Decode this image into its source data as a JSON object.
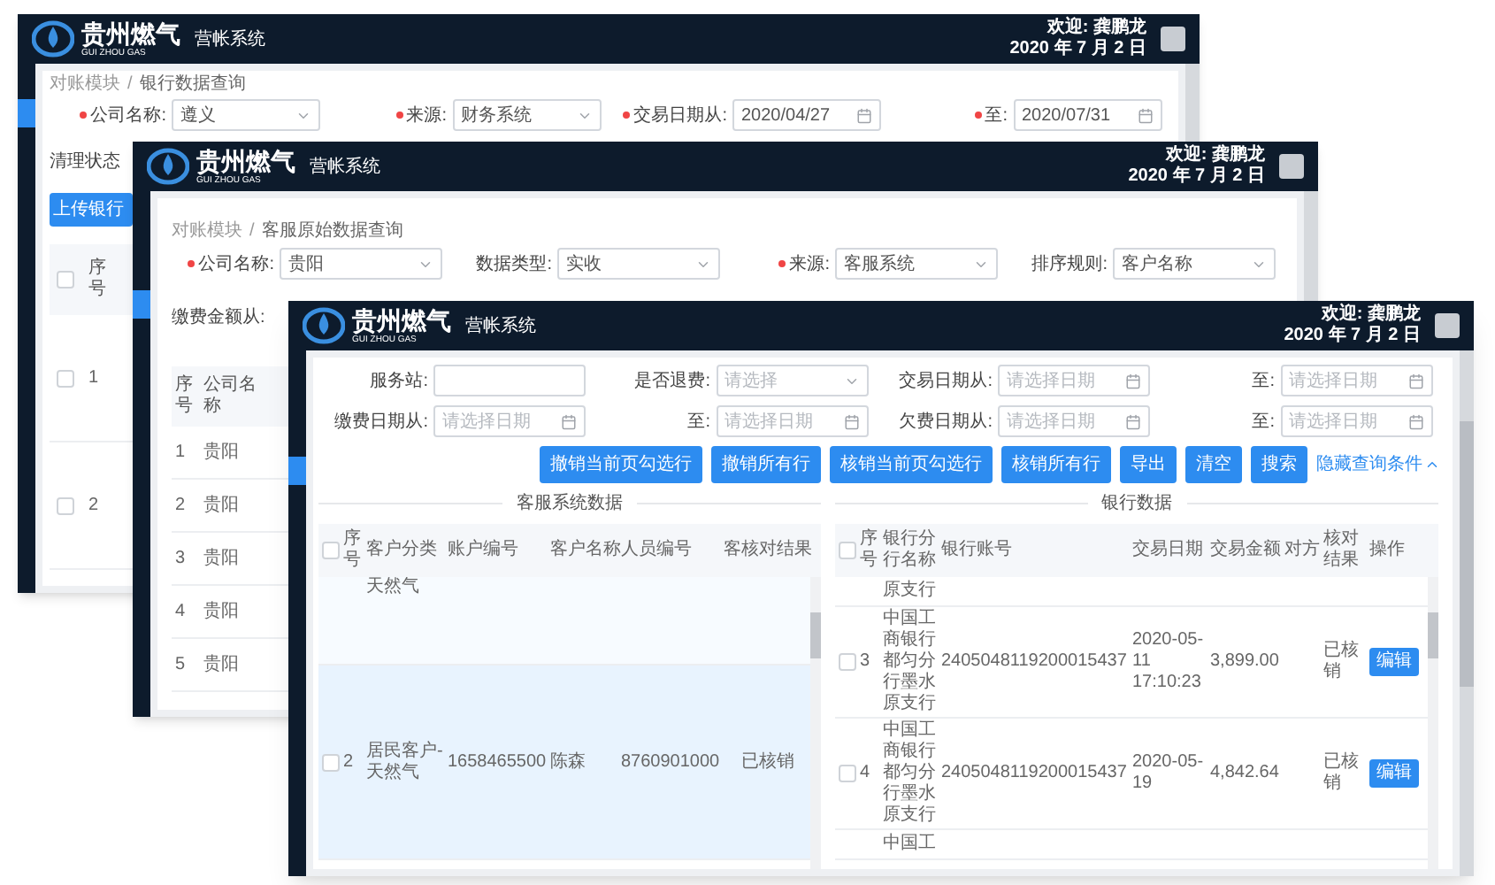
{
  "windows": [
    {
      "header": {
        "brand": "贵州燃气",
        "brand_en": "GUI ZHOU GAS",
        "system": "营帐系统",
        "welcome": "欢迎: 龚鹏龙",
        "date": "2020 年 7 月 2 日"
      },
      "breadcrumb": [
        "对账模块",
        "银行数据查询"
      ],
      "separator": "/",
      "filters": [
        {
          "label": "公司名称:",
          "required": true,
          "kind": "select",
          "value": "遵义"
        },
        {
          "label": "来源:",
          "required": true,
          "kind": "select",
          "value": "财务系统"
        },
        {
          "label": "交易日期从:",
          "required": true,
          "kind": "date",
          "value": "2020/04/27"
        },
        {
          "label": "至:",
          "required": true,
          "kind": "date",
          "value": "2020/07/31"
        }
      ],
      "side_label": "清理状态",
      "side_button": "上传银行",
      "table": {
        "columns": [
          "序号"
        ],
        "header_checked": false,
        "rows": [
          {
            "index": "1",
            "checked": false
          },
          {
            "index": "2",
            "checked": false
          }
        ]
      }
    },
    {
      "header": {
        "brand": "贵州燃气",
        "brand_en": "GUI ZHOU GAS",
        "system": "营帐系统",
        "welcome": "欢迎: 龚鹏龙",
        "date": "2020 年 7 月 2 日"
      },
      "breadcrumb": [
        "对账模块",
        "客服原始数据查询"
      ],
      "separator": "/",
      "filters": [
        {
          "label": "公司名称:",
          "required": true,
          "kind": "select",
          "value": "贵阳"
        },
        {
          "label": "数据类型:",
          "required": false,
          "kind": "select",
          "value": "实收"
        },
        {
          "label": "来源:",
          "required": true,
          "kind": "select",
          "value": "客服系统"
        },
        {
          "label": "排序规则:",
          "required": false,
          "kind": "select",
          "value": "客户名称"
        }
      ],
      "side_label": "缴费金额从:",
      "table": {
        "columns": [
          "序号",
          "公司名称"
        ],
        "rows": [
          {
            "index": "1",
            "company": "贵阳"
          },
          {
            "index": "2",
            "company": "贵阳"
          },
          {
            "index": "3",
            "company": "贵阳"
          },
          {
            "index": "4",
            "company": "贵阳"
          },
          {
            "index": "5",
            "company": "贵阳"
          }
        ]
      }
    },
    {
      "header": {
        "brand": "贵州燃气",
        "brand_en": "GUI ZHOU GAS",
        "system": "营帐系统",
        "welcome": "欢迎: 龚鹏龙",
        "date": "2020 年 7 月 2 日"
      },
      "filters": [
        {
          "label": "服务站:",
          "required": false,
          "kind": "text"
        },
        {
          "label": "是否退费:",
          "required": false,
          "kind": "select",
          "placeholder": "请选择"
        },
        {
          "label": "交易日期从:",
          "required": false,
          "kind": "date",
          "placeholder": "请选择日期"
        },
        {
          "label": "至:",
          "required": false,
          "kind": "date",
          "placeholder": "请选择日期"
        },
        {
          "label": "缴费日期从:",
          "required": false,
          "kind": "date",
          "placeholder": "请选择日期"
        },
        {
          "label": "至:",
          "required": false,
          "kind": "date",
          "placeholder": "请选择日期"
        },
        {
          "label": "欠费日期从:",
          "required": false,
          "kind": "date",
          "placeholder": "请选择日期"
        },
        {
          "label": "至:",
          "required": false,
          "kind": "date",
          "placeholder": "请选择日期"
        }
      ],
      "actions": [
        "撤销当前页勾选行",
        "撤销所有行",
        "核销当前页勾选行",
        "核销所有行",
        "导出",
        "清空",
        "搜索"
      ],
      "toggle_link": "隐藏查询条件",
      "section_titles": [
        "客服系统数据",
        "银行数据"
      ],
      "left_table": {
        "columns": [
          "序号",
          "客户分类",
          "账户编号",
          "客户名称",
          "人员编号",
          "核对结果"
        ],
        "cut_column": "客",
        "header_checked": false,
        "rows": [
          {
            "kind": "partial",
            "category": "天然气"
          },
          {
            "kind": "full",
            "selected": true,
            "checked": false,
            "index": "2",
            "category": "居民客户-天然气",
            "account": "1658465500",
            "name": "陈森",
            "person": "8760901000",
            "result": "已核销"
          }
        ]
      },
      "right_table": {
        "columns": [
          "序号",
          "银行分行名称",
          "银行账号",
          "交易日期",
          "交易金额",
          "对方",
          "核对结果",
          "操作"
        ],
        "header_checked": false,
        "rows": [
          {
            "kind": "partial",
            "branch": "原支行"
          },
          {
            "kind": "full",
            "checked": false,
            "index": "3",
            "branch": "中国工商银行都匀分行墨水原支行",
            "account": "2405048119200015437",
            "date": "2020-05-11 17:10:23",
            "amount": "3,899.00",
            "result": "已核销",
            "action": "编辑"
          },
          {
            "kind": "full",
            "checked": false,
            "index": "4",
            "branch": "中国工商银行都匀分行墨水原支行",
            "account": "2405048119200015437",
            "date": "2020-05-19",
            "amount": "4,842.64",
            "result": "已核销",
            "action": "编辑"
          },
          {
            "kind": "partial",
            "branch": "中国工"
          }
        ]
      }
    }
  ]
}
